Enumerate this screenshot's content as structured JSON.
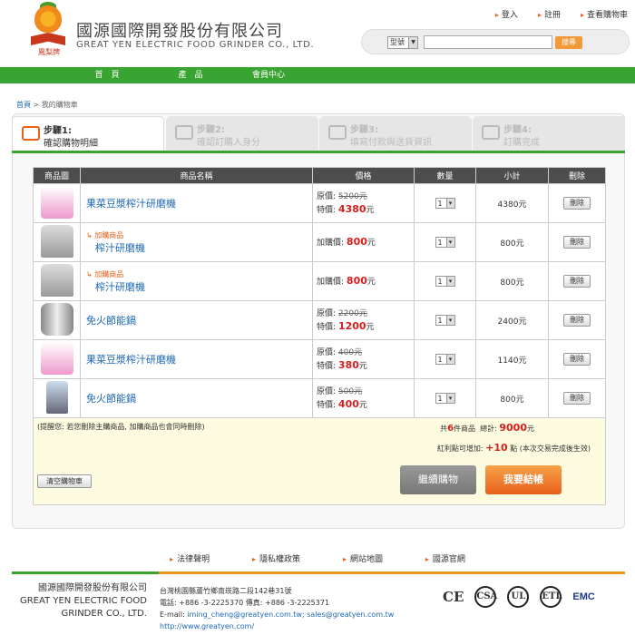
{
  "header": {
    "logo_text": "鳳梨牌",
    "company_zh": "國源國際開發股份有限公司",
    "company_en": "GREAT YEN ELECTRIC FOOD GRINDER CO., LTD.",
    "top_links": [
      "登入",
      "註冊",
      "查看購物車"
    ],
    "search": {
      "select_value": "型號",
      "placeholder": "",
      "button": "搜尋"
    }
  },
  "nav": [
    "首　頁",
    "產　品",
    "會員中心"
  ],
  "breadcrumb": {
    "home": "首頁",
    "sep": ">",
    "current": "我的購物車"
  },
  "steps": [
    {
      "t1": "步驟1:",
      "t2": "確認購物明細",
      "active": true
    },
    {
      "t1": "步驟2:",
      "t2": "確認訂購人身分",
      "active": false
    },
    {
      "t1": "步驟3:",
      "t2": "填寫付款與送貨資訊",
      "active": false
    },
    {
      "t1": "步驟4:",
      "t2": "訂購完成",
      "active": false
    }
  ],
  "table": {
    "headers": [
      "商品圖",
      "商品名稱",
      "價格",
      "數量",
      "小計",
      "刪除"
    ],
    "rows": [
      {
        "img": "food",
        "addon": "",
        "name": "果菜豆漿榨汁研磨機",
        "orig_label": "原價:",
        "orig": "5200元",
        "price_label": "特價:",
        "price": "4380",
        "unit": "元",
        "qty": "1",
        "subtotal": "4380元",
        "del": "刪除"
      },
      {
        "img": "juicer",
        "addon": "加購商品",
        "name": "榨汁研磨機",
        "orig_label": "",
        "orig": "",
        "price_label": "加購價:",
        "price": "800",
        "unit": "元",
        "qty": "1",
        "subtotal": "800元",
        "del": "刪除"
      },
      {
        "img": "juicer",
        "addon": "加購商品",
        "name": "榨汁研磨機",
        "orig_label": "",
        "orig": "",
        "price_label": "加購價:",
        "price": "800",
        "unit": "元",
        "qty": "1",
        "subtotal": "800元",
        "del": "刪除"
      },
      {
        "img": "pot",
        "addon": "",
        "name": "免火節能鍋",
        "orig_label": "原價:",
        "orig": "2200元",
        "price_label": "特價:",
        "price": "1200",
        "unit": "元",
        "qty": "1",
        "subtotal": "2400元",
        "del": "刪除"
      },
      {
        "img": "food",
        "addon": "",
        "name": "果菜豆漿榨汁研磨機",
        "orig_label": "原價:",
        "orig": "400元",
        "price_label": "特價:",
        "price": "380",
        "unit": "元",
        "qty": "1",
        "subtotal": "1140元",
        "del": "刪除"
      },
      {
        "img": "blender",
        "addon": "",
        "name": "免火節能鍋",
        "orig_label": "原價:",
        "orig": "500元",
        "price_label": "特價:",
        "price": "400",
        "unit": "元",
        "qty": "1",
        "subtotal": "800元",
        "del": "刪除"
      }
    ]
  },
  "summary": {
    "note": "(提醒您: 若您刪除主購商品, 加購商品也會同時刪除)",
    "count_prefix": "共",
    "count": "6",
    "count_suffix": "件商品",
    "total_label": "總計:",
    "total": "9000",
    "total_unit": "元",
    "bonus_label": "紅利點可增加:",
    "bonus": "+10",
    "bonus_suffix": "點 (本次交易完成後生效)",
    "clear": "清空購物車",
    "continue": "繼續購物",
    "checkout": "我要結帳"
  },
  "footer": {
    "links": [
      "法律聲明",
      "隱私權政策",
      "網站地圖",
      "國源官網"
    ],
    "company_zh": "國源國際開發股份有限公司",
    "company_en_1": "GREAT YEN ELECTRIC FOOD",
    "company_en_2": "GRINDER CO., LTD.",
    "address": "台灣桃園縣蘆竹鄉南崁路二段142巷31號",
    "phone": "電話: +886 -3-2225370 傳真: +886 -3-2225371",
    "email_label": "E-mail: ",
    "email": "iming_cheng@greatyen.com.tw; sales@greatyen.com.tw",
    "url": "http://www.greatyen.com/",
    "certs": [
      "CE",
      "CSA",
      "UL",
      "ETL",
      "EMC"
    ]
  }
}
